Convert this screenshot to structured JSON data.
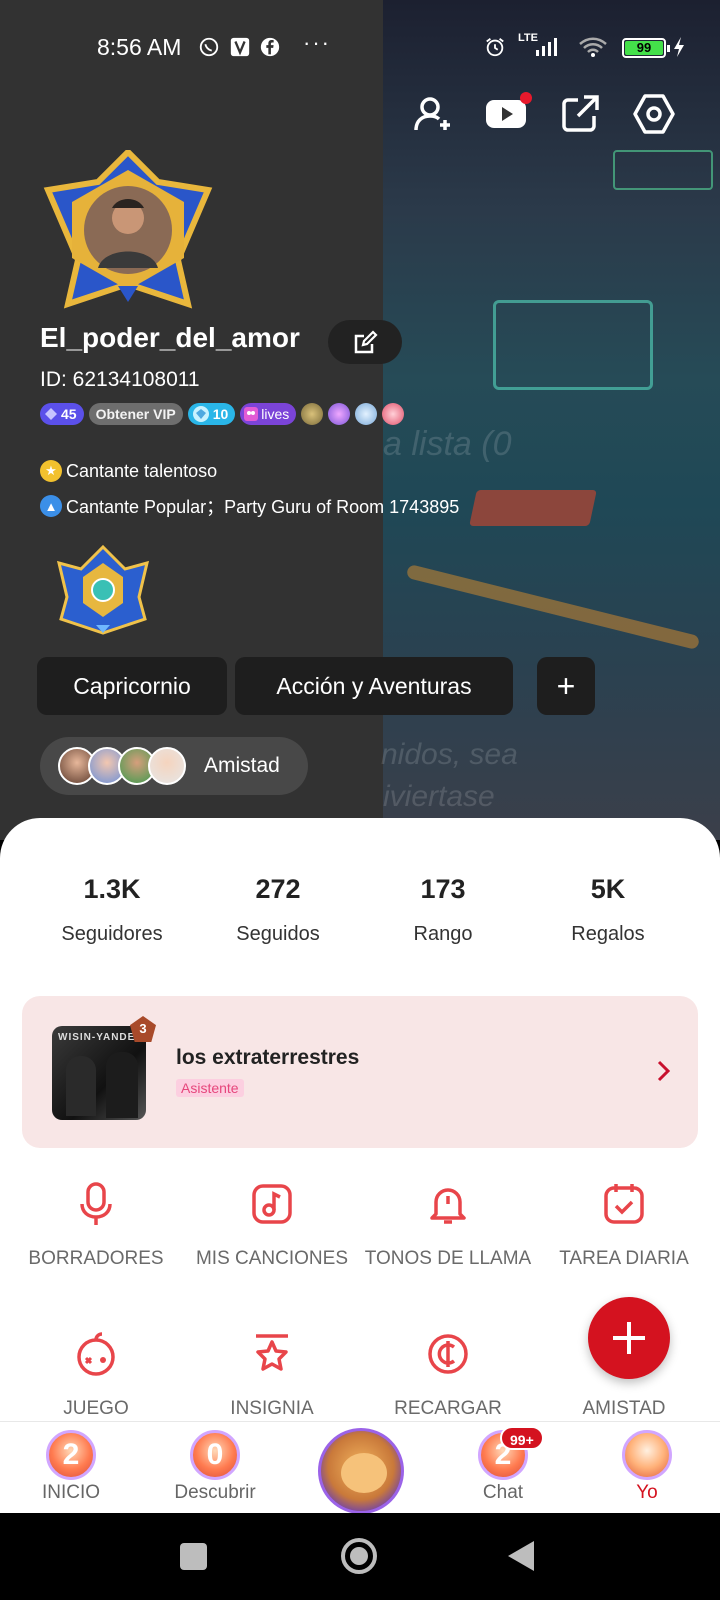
{
  "status_bar": {
    "time": "8:56 AM",
    "network": "LTE",
    "battery": "99",
    "notification_icons": [
      "whatsapp-icon",
      "app-icon",
      "facebook-icon"
    ],
    "more": "···"
  },
  "top_actions": [
    "add-friend-icon",
    "youtube-icon",
    "share-icon",
    "settings-icon"
  ],
  "profile": {
    "username": "El_poder_del_amor",
    "id_text": "ID: 62134108011",
    "level": "45",
    "vip_label": "Obtener VIP",
    "diamond_level": "10",
    "lives_label": "lives",
    "titles": [
      "Cantante talentoso",
      "Cantante Popular；Party Guru of Room 1743895"
    ],
    "tags": [
      "Capricornio",
      "Acción y Aventuras"
    ],
    "add_tag": "+",
    "friendship_label": "Amistad"
  },
  "stats": [
    {
      "value": "1.3K",
      "label": "Seguidores"
    },
    {
      "value": "272",
      "label": "Seguidos"
    },
    {
      "value": "173",
      "label": "Rango"
    },
    {
      "value": "5K",
      "label": "Regalos"
    }
  ],
  "room": {
    "cover_text": "WISIN-YANDEL",
    "rank": "3",
    "name": "los extraterrestres",
    "role": "Asistente"
  },
  "features": [
    {
      "label": "BORRADORES",
      "icon": "microphone-icon"
    },
    {
      "label": "MIS CANCIONES",
      "icon": "music-note-icon"
    },
    {
      "label": "TONOS DE LLAMA",
      "icon": "bell-icon"
    },
    {
      "label": "TAREA DIARIA",
      "icon": "calendar-check-icon"
    },
    {
      "label": "JUEGO",
      "icon": "game-icon"
    },
    {
      "label": "INSIGNIA",
      "icon": "badge-star-icon"
    },
    {
      "label": "RECARGAR",
      "icon": "coin-icon"
    },
    {
      "label": "AMISTAD",
      "icon": "friendship-icon"
    }
  ],
  "bottom_nav": {
    "items": [
      {
        "label": "INICIO",
        "glyph": "2"
      },
      {
        "label": "Descubrir",
        "glyph": "0"
      },
      {
        "label": "Chat",
        "glyph": "2"
      },
      {
        "label": "Yo",
        "glyph": ""
      }
    ],
    "chat_badge": "99+"
  },
  "colors": {
    "accent": "#d4121f",
    "icon_red": "#e8454a",
    "header_bg": "#323232",
    "room_card_bg": "#f8e6e6"
  }
}
